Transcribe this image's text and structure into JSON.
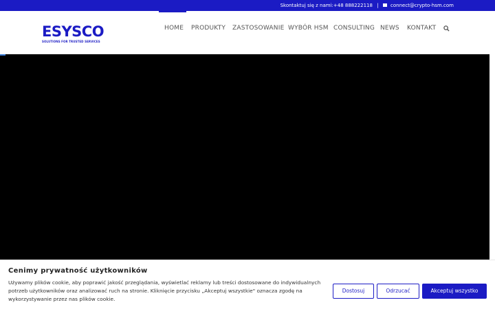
{
  "topbar": {
    "contact_text": "Skontaktuj się z nami:+48 888222118",
    "email": "connect@crypto-hsm.com"
  },
  "logo": {
    "word": "ESYSCO",
    "tagline": "SOLUTIONS FOR TRUSTED SERVICES"
  },
  "nav": {
    "items": [
      {
        "label": "HOME",
        "active": true
      },
      {
        "label": "PRODUKTY"
      },
      {
        "label": "ZASTOSOWANIE"
      },
      {
        "label": "WYBÓR HSM"
      },
      {
        "label": "CONSULTING"
      },
      {
        "label": "NEWS"
      },
      {
        "label": "KONTAKT"
      }
    ]
  },
  "cookie": {
    "title": "Cenimy prywatność użytkowników",
    "text": "Używamy plików cookie, aby poprawić jakość przeglądania, wyświetlać reklamy lub treści dostosowane do indywidualnych potrzeb użytkowników oraz analizować ruch na stronie. Kliknięcie przycisku „Akceptuj wszystkie\" oznacza zgodę na wykorzystywanie przez nas plików cookie.",
    "buttons": {
      "customize": "Dostosuj",
      "reject": "Odrzucać",
      "accept": "Akceptuj wszystko"
    }
  },
  "colors": {
    "brand": "#1b1bc4",
    "hero": "#000000"
  }
}
